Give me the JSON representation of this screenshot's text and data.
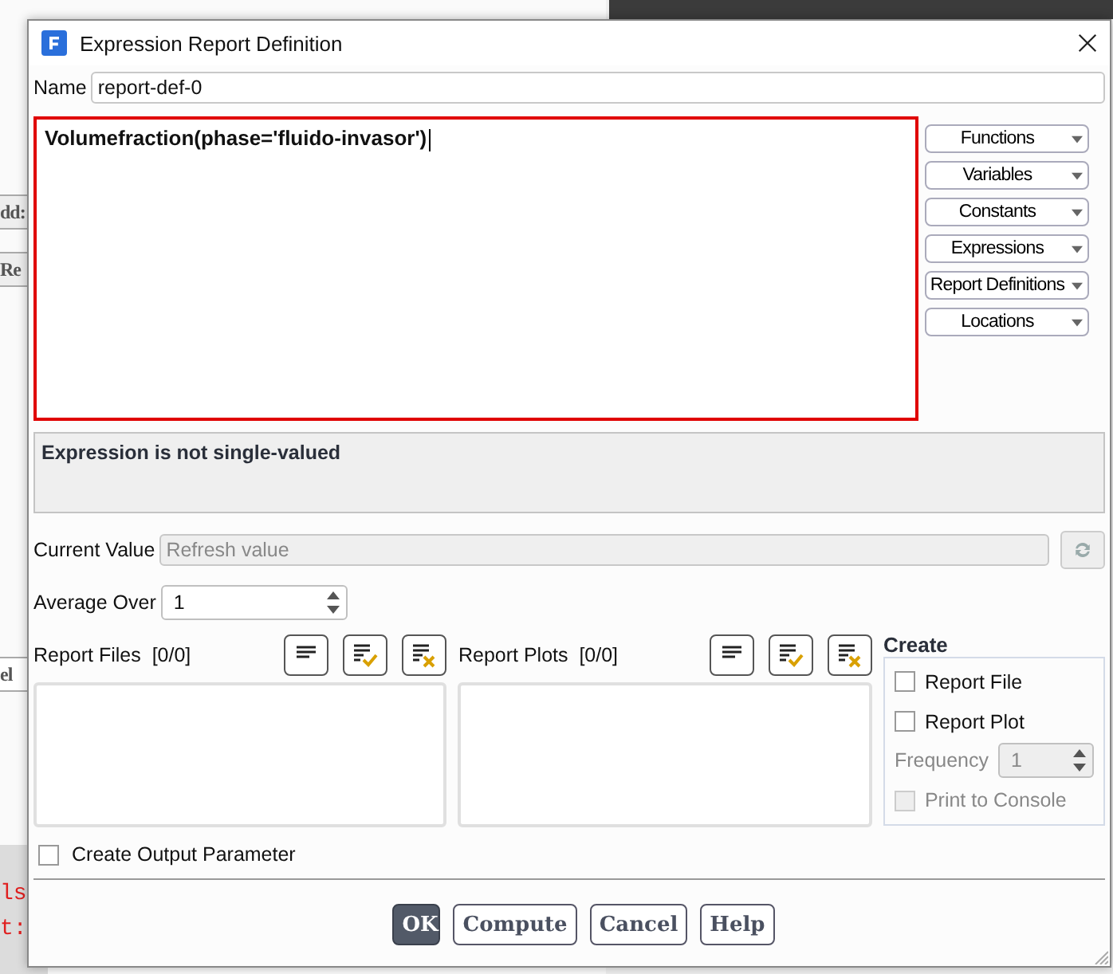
{
  "background": {
    "buttons": [
      "dd:",
      "Re",
      "el"
    ],
    "console_lines": [
      "ls",
      "t:"
    ]
  },
  "window": {
    "title": "Expression Report Definition"
  },
  "name": {
    "label": "Name",
    "value": "report-def-0"
  },
  "expression": {
    "value": "Volumefraction(phase='fluido-invasor')"
  },
  "insert_menus": [
    "Functions",
    "Variables",
    "Constants",
    "Expressions",
    "Report Definitions",
    "Locations"
  ],
  "message": "Expression is not single-valued",
  "current_value": {
    "label": "Current Value",
    "placeholder": "Refresh value"
  },
  "average_over": {
    "label": "Average Over",
    "value": "1"
  },
  "lists": [
    {
      "label": "Report Files",
      "count": "[0/0]"
    },
    {
      "label": "Report Plots",
      "count": "[0/0]"
    }
  ],
  "create": {
    "title": "Create",
    "options": [
      {
        "label": "Report File",
        "checked": false
      },
      {
        "label": "Report Plot",
        "checked": false
      }
    ],
    "frequency": {
      "label": "Frequency",
      "value": "1",
      "disabled": true
    },
    "print_to_console": {
      "label": "Print to Console",
      "checked": false,
      "disabled": true
    }
  },
  "create_output_parameter": {
    "label": "Create Output Parameter",
    "checked": false
  },
  "buttons": [
    {
      "label": "OK",
      "primary": true
    },
    {
      "label": "Compute",
      "primary": false
    },
    {
      "label": "Cancel",
      "primary": false
    },
    {
      "label": "Help",
      "primary": false
    }
  ]
}
